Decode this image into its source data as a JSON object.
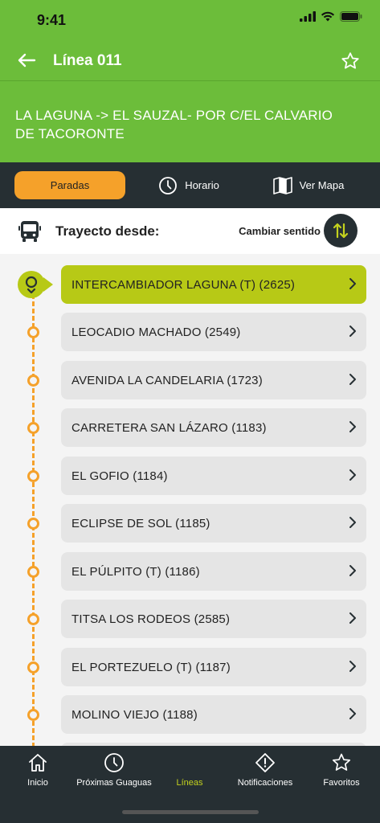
{
  "status": {
    "time": "9:41"
  },
  "nav": {
    "title": "Línea 011"
  },
  "route": {
    "name": "LA LAGUNA -> EL SAUZAL- POR C/EL CALVARIO DE TACORONTE"
  },
  "tabs": [
    {
      "label": "Paradas"
    },
    {
      "label": "Horario"
    },
    {
      "label": "Ver Mapa"
    }
  ],
  "direction": {
    "label": "Trayecto desde:",
    "change_label": "Cambiar sentido"
  },
  "stops": [
    {
      "label": "INTERCAMBIADOR LAGUNA (T) (2625)"
    },
    {
      "label": "LEOCADIO MACHADO (2549)"
    },
    {
      "label": "AVENIDA LA CANDELARIA (1723)"
    },
    {
      "label": "CARRETERA SAN LÁZARO (1183)"
    },
    {
      "label": "EL GOFIO (1184)"
    },
    {
      "label": "ECLIPSE DE SOL (1185)"
    },
    {
      "label": "EL PÚLPITO (T) (1186)"
    },
    {
      "label": "TITSA LOS RODEOS (2585)"
    },
    {
      "label": "EL PORTEZUELO (T) (1187)"
    },
    {
      "label": "MOLINO VIEJO (1188)"
    }
  ],
  "bottom_nav": [
    {
      "label": "Inicio"
    },
    {
      "label": "Próximas Guaguas"
    },
    {
      "label": "Líneas"
    },
    {
      "label": "Notificaciones"
    },
    {
      "label": "Favoritos"
    }
  ],
  "colors": {
    "header_green": "#6cbd3a",
    "accent_orange": "#f5a12a",
    "active_stop": "#b7c916",
    "dark_bar": "#262f33",
    "active_nav": "#c4d21e"
  }
}
